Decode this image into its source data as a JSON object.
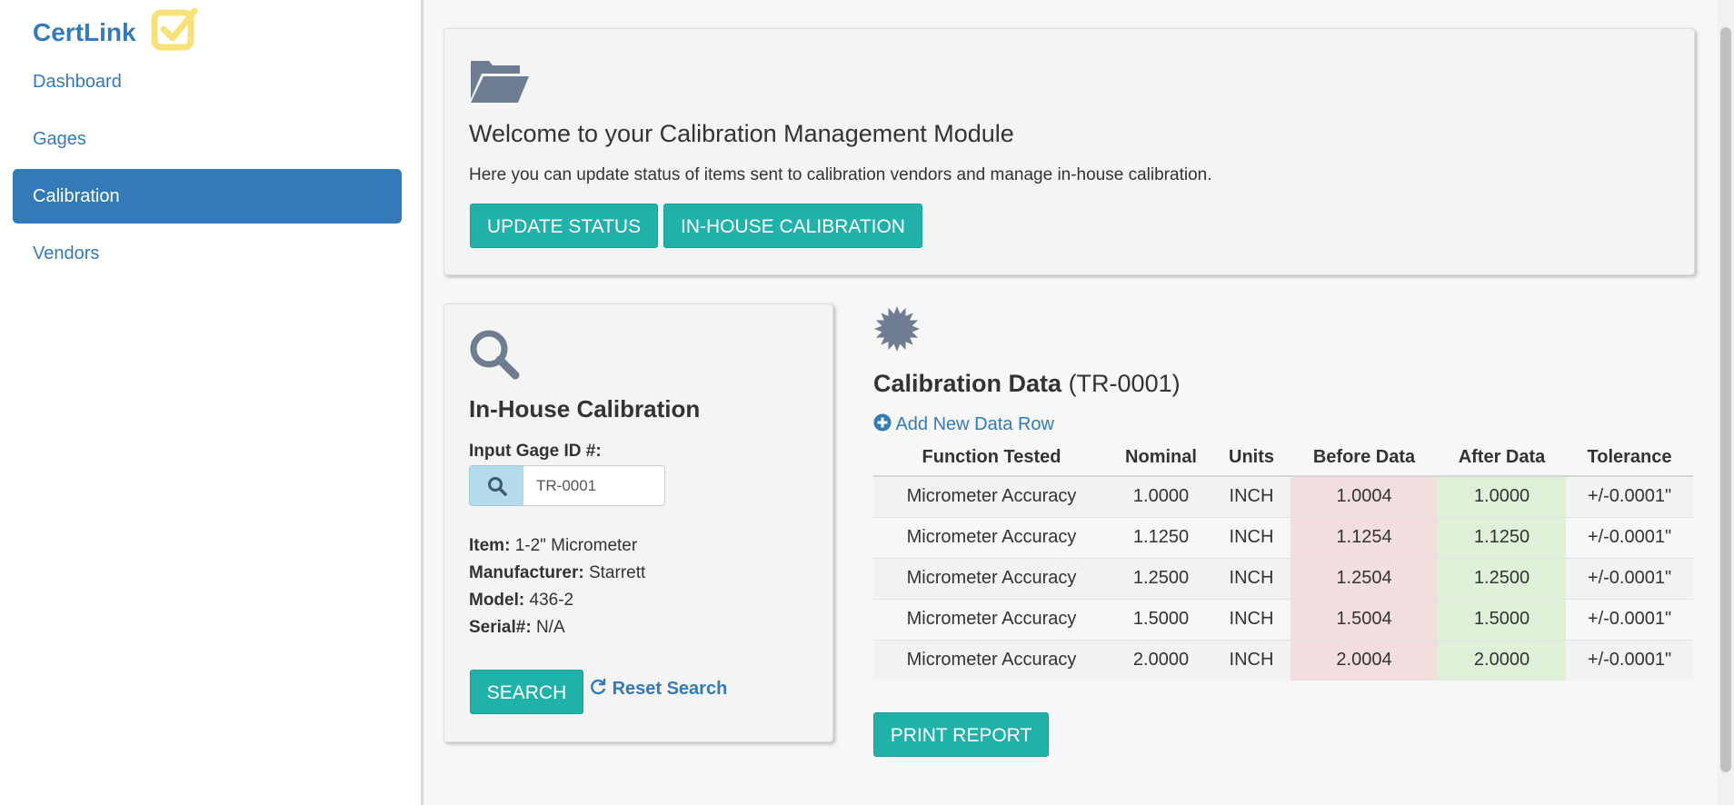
{
  "sidebar": {
    "brand": "CertLink",
    "items": [
      {
        "label": "Dashboard"
      },
      {
        "label": "Gages"
      },
      {
        "label": "Calibration"
      },
      {
        "label": "Vendors"
      }
    ],
    "active": "Calibration"
  },
  "welcome": {
    "icon": "folder-open-icon",
    "title": "Welcome to your Calibration Management Module",
    "text": "Here you can update status of items sent to calibration vendors and manage in-house calibration.",
    "update_status_label": "UPDATE STATUS",
    "in_house_label": "IN-HOUSE CALIBRATION"
  },
  "search_panel": {
    "icon": "magnifier-icon",
    "title": "In-House Calibration",
    "gage_label": "Input Gage ID #:",
    "gage_value": "TR-0001",
    "item_label": "Item:",
    "item_value": "1-2\" Micrometer",
    "manufacturer_label": "Manufacturer:",
    "manufacturer_value": "Starrett",
    "model_label": "Model:",
    "model_value": "436-2",
    "serial_label": "Serial#:",
    "serial_value": "N/A",
    "search_label": "SEARCH",
    "reset_label": "Reset Search"
  },
  "calibration": {
    "icon": "starburst-icon",
    "title": "Calibration Data",
    "gage_id": "(TR-0001)",
    "add_row_label": "Add New Data Row",
    "columns": [
      "Function Tested",
      "Nominal",
      "Units",
      "Before Data",
      "After Data",
      "Tolerance"
    ],
    "rows": [
      [
        "Micrometer Accuracy",
        "1.0000",
        "INCH",
        "1.0004",
        "1.0000",
        "+/-0.0001\""
      ],
      [
        "Micrometer Accuracy",
        "1.1250",
        "INCH",
        "1.1254",
        "1.1250",
        "+/-0.0001\""
      ],
      [
        "Micrometer Accuracy",
        "1.2500",
        "INCH",
        "1.2504",
        "1.2500",
        "+/-0.0001\""
      ],
      [
        "Micrometer Accuracy",
        "1.5000",
        "INCH",
        "1.5004",
        "1.5000",
        "+/-0.0001\""
      ],
      [
        "Micrometer Accuracy",
        "2.0000",
        "INCH",
        "2.0004",
        "2.0000",
        "+/-0.0001\""
      ]
    ],
    "print_label": "PRINT REPORT"
  },
  "colors": {
    "accent": "#20b2aa",
    "link": "#337ab7",
    "before_cell": "#f2dede",
    "after_cell": "#dff0d8",
    "logo": "#f7e27a"
  }
}
